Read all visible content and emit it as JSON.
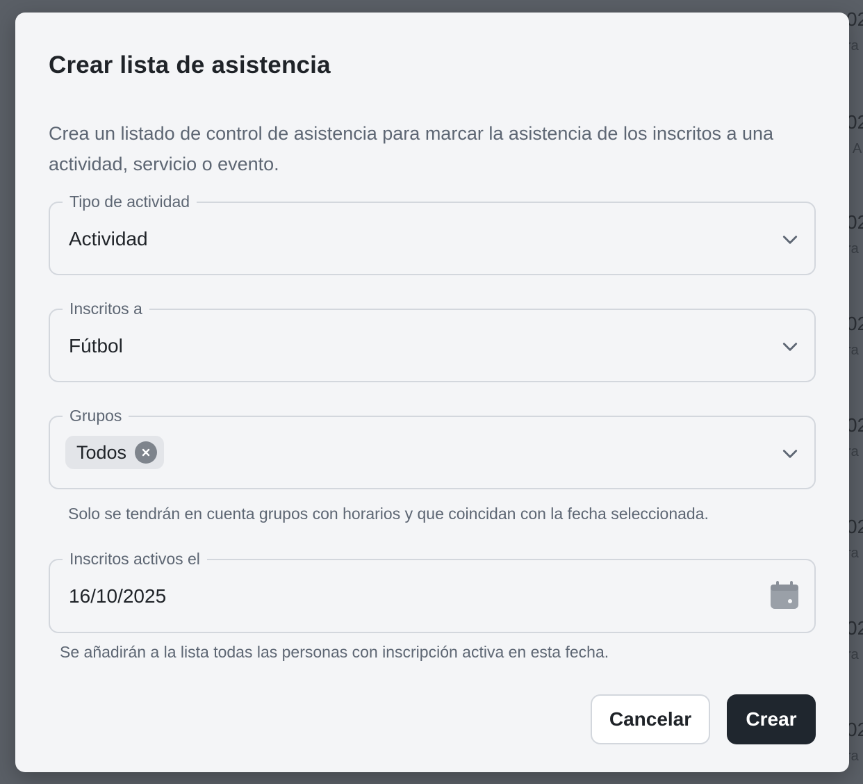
{
  "modal": {
    "title": "Crear lista de asistencia",
    "description": "Crea un listado de control de asistencia para marcar la asistencia de los inscritos a una actividad, servicio o evento."
  },
  "fields": {
    "activity_type": {
      "label": "Tipo de actividad",
      "value": "Actividad",
      "icon": "chevron-down-icon"
    },
    "enrolled_in": {
      "label": "Inscritos a",
      "value": "Fútbol",
      "icon": "chevron-down-icon"
    },
    "groups": {
      "label": "Grupos",
      "chips": [
        "Todos"
      ],
      "helper": "Solo se tendrán en cuenta grupos con horarios y que coincidan con la fecha seleccionada.",
      "icon": "chevron-down-icon"
    },
    "active_on": {
      "label": "Inscritos activos el",
      "value": "16/10/2025",
      "helper": "Se añadirán a la lista todas las personas con inscripción activa en esta fecha.",
      "icon": "calendar-icon"
    }
  },
  "actions": {
    "cancel_label": "Cancelar",
    "create_label": "Crear"
  },
  "colors": {
    "primary_button": "#1f262e",
    "modal_background": "#f4f5f7",
    "backdrop": "#5a5f66"
  }
}
